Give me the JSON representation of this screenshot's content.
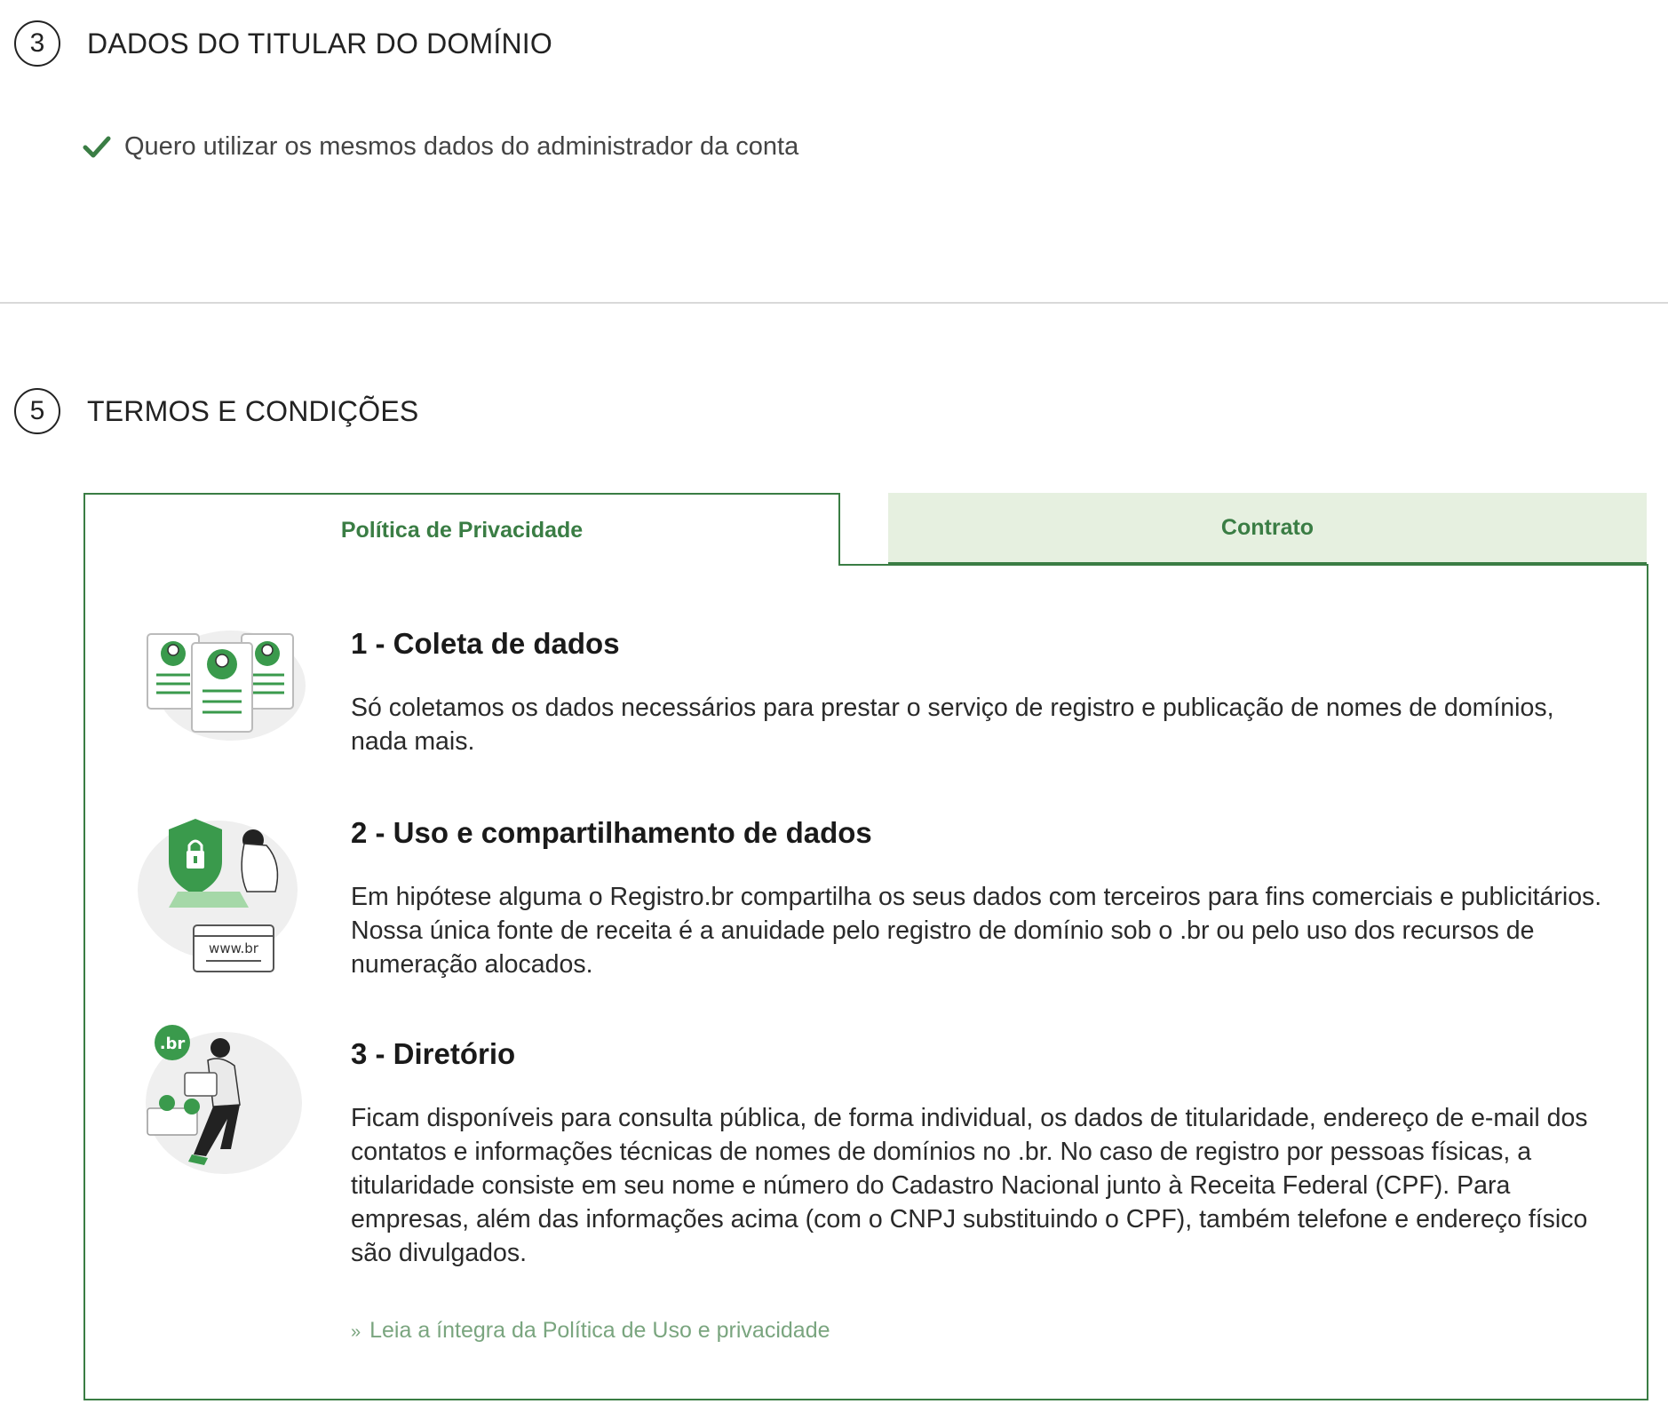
{
  "step3": {
    "number": "3",
    "title": "DADOS DO TITULAR DO DOMÍNIO"
  },
  "checkbox": {
    "label": "Quero utilizar os mesmos dados do administrador da conta",
    "checked": true
  },
  "step5": {
    "number": "5",
    "title": "TERMOS E CONDIÇÕES"
  },
  "tabs": [
    {
      "label": "Política de Privacidade",
      "active": true
    },
    {
      "label": "Contrato",
      "active": false
    }
  ],
  "sections": [
    {
      "title": "1 - Coleta de dados",
      "body": "Só coletamos os dados necessários para prestar o serviço de registro e publicação de nomes de domínios, nada mais.",
      "icon": "profile-cards-illustration"
    },
    {
      "title": "2 - Uso e compartilhamento de dados",
      "body": "Em hipótese alguma o Registro.br compartilha os seus dados com terceiros para fins comerciais e publicitários. Nossa única fonte de receita é a anuidade pelo registro de domínio sob o .br ou pelo uso dos recursos de numeração alocados.",
      "icon": "security-shield-illustration",
      "illustration_text": "www.br"
    },
    {
      "title": "3 - Diretório",
      "body": "Ficam disponíveis para consulta pública, de forma individual, os dados de titularidade, endereço de e-mail dos contatos e informações técnicas de nomes de domínios no .br. No caso de registro por pessoas físicas, a titularidade consiste em seu nome e número do Cadastro Nacional junto à Receita Federal (CPF). Para empresas, além das informações acima (com o CNPJ substituindo o CPF), também telefone e endereço físico são divulgados.",
      "icon": "directory-person-illustration",
      "illustration_text": ".br"
    }
  ],
  "link": {
    "chevron": "»",
    "label": "Leia a íntegra da Política de Uso e privacidade"
  },
  "colors": {
    "accent": "#3a7d44",
    "tab_inactive_bg": "#e6f0e0",
    "link": "#7aa57f"
  }
}
